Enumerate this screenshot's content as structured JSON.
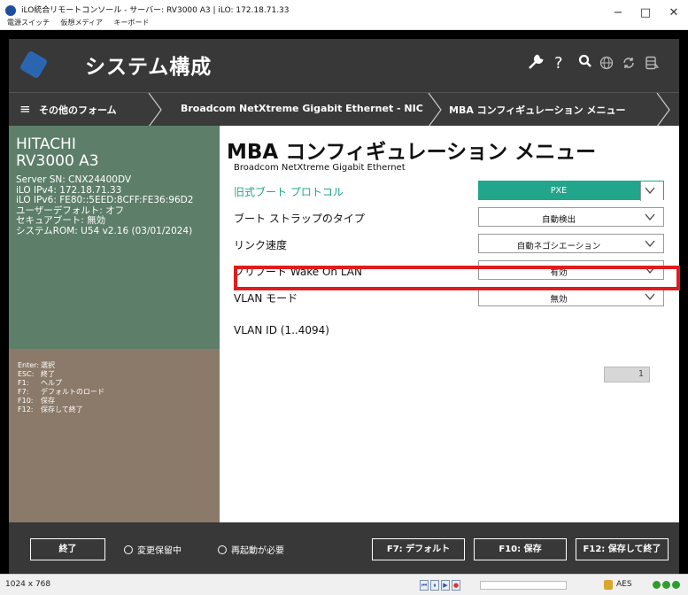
{
  "window": {
    "title": "iLO統合リモートコンソール - サーバー: RV3000 A3 | iLO: 172.18.71.33",
    "menu": [
      "電源スイッチ",
      "仮想メディア",
      "キーボード"
    ],
    "min": "−",
    "max": "□",
    "close": "✕"
  },
  "header": {
    "title": "システム構成",
    "icons": [
      "wrench-icon",
      "help-icon",
      "search-icon",
      "globe-icon",
      "refresh-icon",
      "database-icon"
    ],
    "help": "?"
  },
  "breadcrumb": {
    "menu_glyph": "≡",
    "items": [
      "その他のフォーム",
      "Broadcom NetXtreme Gigabit Ethernet - NIC",
      "MBA コンフィギュレーション メニュー"
    ]
  },
  "sidebar": {
    "vendor": "HITACHI",
    "model": "RV3000 A3",
    "info": [
      "Server SN: CNX24400DV",
      "iLO IPv4: 172.18.71.33",
      "iLO IPv6: FE80::5EED:8CFF:FE36:96D2",
      "ユーザーデフォルト: オフ",
      "セキュアブート: 無効",
      "システムROM: U54 v2.16 (03/01/2024)"
    ],
    "keys": [
      {
        "key": "Enter:",
        "desc": "選択"
      },
      {
        "key": "ESC:",
        "desc": "終了"
      },
      {
        "key": "F1:",
        "desc": "ヘルプ"
      },
      {
        "key": "F7:",
        "desc": "デフォルトのロード"
      },
      {
        "key": "F10:",
        "desc": "保存"
      },
      {
        "key": "F12:",
        "desc": "保存して終了"
      }
    ]
  },
  "main": {
    "title": "MBA コンフィギュレーション メニュー",
    "subtitle": "Broadcom NetXtreme Gigabit Ethernet",
    "rows": [
      {
        "label": "旧式ブート プロトコル",
        "value": "PXE"
      },
      {
        "label": "ブート ストラップのタイプ",
        "value": "自動検出"
      },
      {
        "label": "リンク速度",
        "value": "自動ネゴシエーション"
      },
      {
        "label": "プリブート Wake On LAN",
        "value": "有効"
      },
      {
        "label": "VLAN モード",
        "value": "無効"
      }
    ],
    "vlan_id": {
      "label": "VLAN ID (1..4094)",
      "value": "1"
    }
  },
  "footer": {
    "exit": "終了",
    "pending": "変更保留中",
    "reboot": "再起動が必要",
    "f7": "F7: デフォルト",
    "f10": "F10: 保存",
    "f12": "F12: 保存して終了"
  },
  "statusbar": {
    "resolution": "1024 x 768",
    "controls": [
      "⏮",
      "⏸",
      "▶",
      "●"
    ],
    "encryption": "AES"
  },
  "colors": {
    "header_bg": "#383838",
    "sidebar_top": "#5d7e68",
    "sidebar_bottom": "#8b7a69",
    "accent_teal": "#21a58b",
    "highlight_red": "#e21c1c"
  }
}
